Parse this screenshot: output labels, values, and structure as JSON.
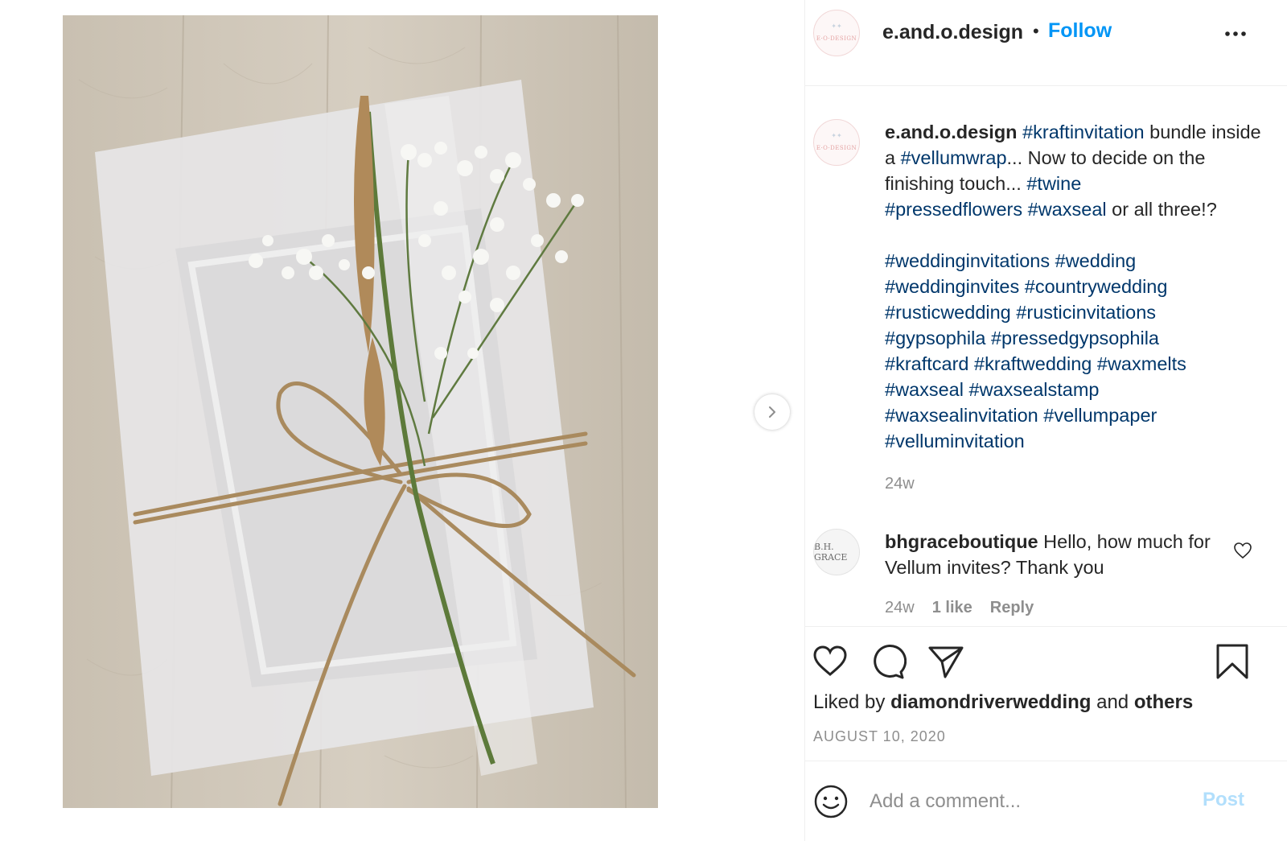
{
  "post": {
    "username": "e.and.o.design",
    "follow_label": "Follow",
    "avatar_text": "E·O·DESIGN",
    "caption": {
      "username": "e.and.o.design",
      "tag_kraftinvitation": "#kraftinvitation",
      "text_1": " bundle inside a ",
      "tag_vellumwrap": "#vellumwrap",
      "text_2": "... Now to decide on the finishing touch... ",
      "tag_twine": "#twine",
      "tag_pressedflowers": "#pressedflowers",
      "tag_waxseal": "#waxseal",
      "text_3": " or all three!?",
      "tags": [
        "#weddinginvitations",
        "#wedding",
        "#weddinginvites",
        "#countrywedding",
        "#rusticwedding",
        "#rusticinvitations",
        "#gypsophila",
        "#pressedgypsophila",
        "#kraftcard",
        "#kraftwedding",
        "#waxmelts",
        "#waxseal",
        "#waxsealstamp",
        "#waxsealinvitation",
        "#vellumpaper",
        "#velluminvitation"
      ],
      "time": "24w"
    },
    "comment": {
      "avatar_text": "B.H. GRACE",
      "username": "bhgraceboutique",
      "text": " Hello, how much for Vellum invites? Thank you",
      "time": "24w",
      "likes": "1 like",
      "reply_label": "Reply"
    },
    "liked_by": {
      "prefix": "Liked by ",
      "user": "diamondriverwedding",
      "middle": " and ",
      "others": "others"
    },
    "date": "AUGUST 10, 2020",
    "add_comment": {
      "placeholder": "Add a comment...",
      "post_label": "Post"
    }
  },
  "colors": {
    "link_blue": "#0095f6",
    "hashtag": "#00376b",
    "muted": "#8e8e8e",
    "post_disabled": "#b2dffc"
  },
  "icons": [
    "chevron-right-icon",
    "more-icon",
    "heart-icon",
    "comment-icon",
    "share-icon",
    "bookmark-icon",
    "emoji-icon"
  ]
}
